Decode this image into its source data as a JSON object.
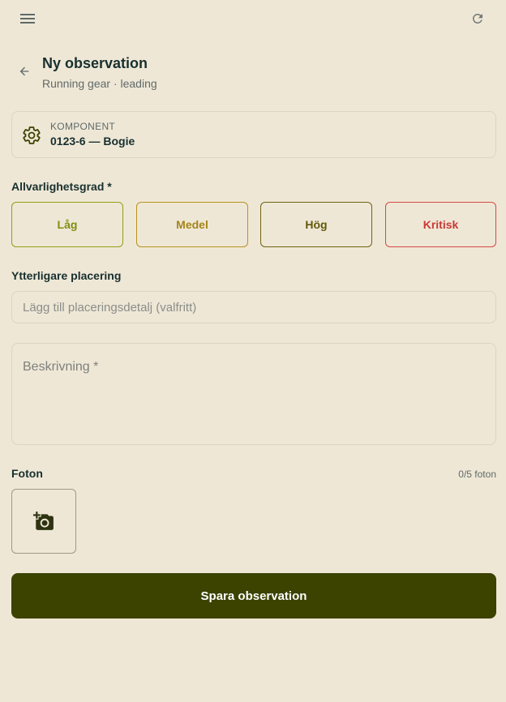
{
  "topbar": {
    "menu_icon": "hamburger-menu-icon",
    "refresh_icon": "refresh-icon"
  },
  "header": {
    "back_icon": "arrow-left-icon",
    "title": "Ny observation",
    "subtitle": "Running gear · leading"
  },
  "component": {
    "icon": "gear-icon",
    "label": "KOMPONENT",
    "value": "0123-6 — Bogie"
  },
  "severity": {
    "label": "Allvarlighetsgrad *",
    "options": [
      "Låg",
      "Medel",
      "Hög",
      "Kritisk"
    ],
    "colors": {
      "low": "#7d8e10",
      "medium": "#a4851a",
      "high": "#615808",
      "critical": "#c83a36"
    }
  },
  "placement": {
    "label": "Ytterligare placering",
    "placeholder": "Lägg till placeringsdetalj (valfritt)",
    "value": ""
  },
  "description": {
    "placeholder": "Beskrivning *",
    "value": ""
  },
  "photos": {
    "label": "Foton",
    "count_text": "0/5 foton",
    "add_icon": "add-photo-camera-icon"
  },
  "actions": {
    "save_label": "Spara observation"
  },
  "colors": {
    "background": "#efe7d6",
    "primary": "#3c4200",
    "text": "#17302f"
  }
}
